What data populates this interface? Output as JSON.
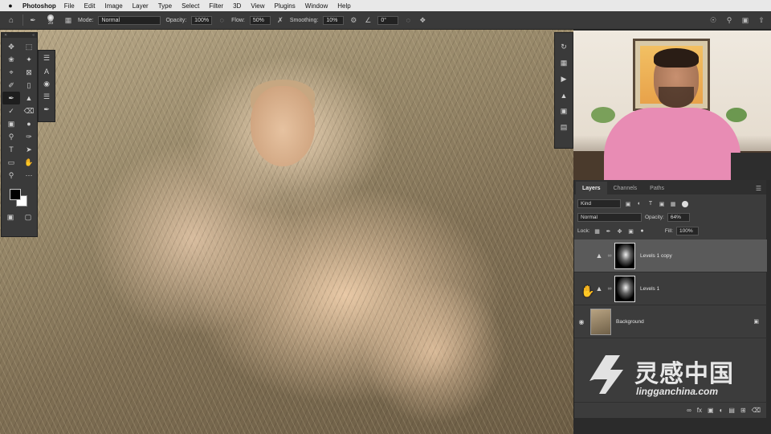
{
  "menubar": {
    "apple": "",
    "app": "Photoshop",
    "items": [
      "File",
      "Edit",
      "Image",
      "Layer",
      "Type",
      "Select",
      "Filter",
      "3D",
      "View",
      "Plugins",
      "Window",
      "Help"
    ]
  },
  "options": {
    "brush_size": "35",
    "mode_label": "Mode:",
    "mode_value": "Normal",
    "opacity_label": "Opacity:",
    "opacity_value": "100%",
    "flow_label": "Flow:",
    "flow_value": "50%",
    "smoothing_label": "Smoothing:",
    "smoothing_value": "10%",
    "angle_value": "0°"
  },
  "layers_panel": {
    "tabs": [
      "Layers",
      "Channels",
      "Paths"
    ],
    "filter_kind": "Kind",
    "blend_mode": "Normal",
    "opacity_label": "Opacity:",
    "opacity_value": "64%",
    "lock_label": "Lock:",
    "fill_label": "Fill:",
    "fill_value": "100%",
    "layers": [
      {
        "name": "Levels 1 copy",
        "visible": false,
        "selected": true
      },
      {
        "name": "Levels 1",
        "visible": false,
        "selected": false
      },
      {
        "name": "Background",
        "visible": true,
        "selected": false
      }
    ]
  },
  "watermark": {
    "cn": "灵感中国",
    "en": "lingganchina.com"
  },
  "colors": {
    "foreground": "#000000",
    "background": "#ffffff",
    "panel": "#3c3c3c"
  }
}
